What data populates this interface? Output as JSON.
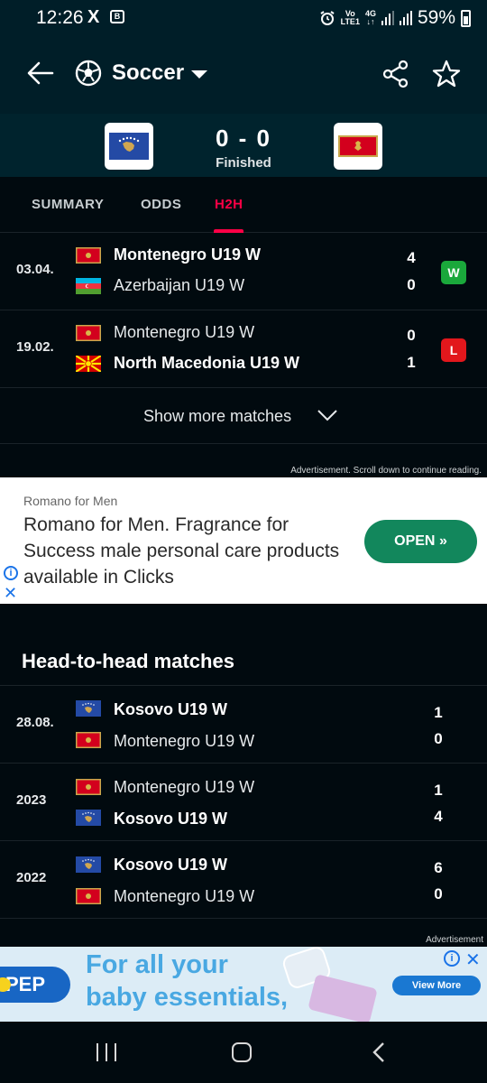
{
  "status_bar": {
    "time": "12:26",
    "x_icon": "X",
    "msg_icon": "B",
    "net_top": "Vo",
    "net_bottom": "LTE1",
    "net_4g": "4G",
    "battery": "59%"
  },
  "header": {
    "sport": "Soccer",
    "icons": [
      "arrow-left-icon",
      "soccer-ball-icon",
      "caret-down-icon",
      "share-icon",
      "star-icon"
    ]
  },
  "match": {
    "score": "0 - 0",
    "status": "Finished",
    "home_crest": "kosovo-flag",
    "away_crest": "montenegro-flag"
  },
  "tabs": [
    {
      "label": "SUMMARY",
      "active": false
    },
    {
      "label": "ODDS",
      "active": false
    },
    {
      "label": "H2H",
      "active": true
    }
  ],
  "last_matches": [
    {
      "date": "03.04.",
      "team1": "Montenegro U19 W",
      "flag1": "montenegro",
      "score1": "4",
      "team2": "Azerbaijan U19 W",
      "flag2": "azerbaijan",
      "score2": "0",
      "winner": 1,
      "result": "W"
    },
    {
      "date": "19.02.",
      "team1": "Montenegro U19 W",
      "flag1": "montenegro",
      "score1": "0",
      "team2": "North Macedonia U19 W",
      "flag2": "north-macedonia",
      "score2": "1",
      "winner": 2,
      "result": "L"
    }
  ],
  "show_more": "Show more matches",
  "ad1": {
    "note": "Advertisement. Scroll down to continue reading.",
    "advertiser": "Romano for Men",
    "text": "Romano for Men. Fragrance for Success male personal care products available in Clicks",
    "button": "OPEN",
    "button_icon": "»",
    "info_icon": "i",
    "close_icon": "✕"
  },
  "h2h_title": "Head-to-head matches",
  "h2h_matches": [
    {
      "date": "28.08.",
      "team1": "Kosovo U19 W",
      "flag1": "kosovo",
      "score1": "1",
      "team2": "Montenegro U19 W",
      "flag2": "montenegro",
      "score2": "0",
      "winner": 1
    },
    {
      "date": "2023",
      "team1": "Montenegro U19 W",
      "flag1": "montenegro",
      "score1": "1",
      "team2": "Kosovo U19 W",
      "flag2": "kosovo",
      "score2": "4",
      "winner": 2
    },
    {
      "date": "2022",
      "team1": "Kosovo U19 W",
      "flag1": "kosovo",
      "score1": "6",
      "team2": "Montenegro U19 W",
      "flag2": "montenegro",
      "score2": "0",
      "winner": 1
    }
  ],
  "ad2": {
    "note": "Advertisement",
    "brand": "PEP",
    "line1": "For all your",
    "line2": "baby essentials,",
    "button": "View More",
    "info_icon": "i",
    "close_icon": "✕"
  },
  "colors": {
    "background": "#010a0f",
    "header": "#001e28",
    "accent": "#ff0046",
    "win": "#1aa83b",
    "loss": "#e2171c"
  }
}
